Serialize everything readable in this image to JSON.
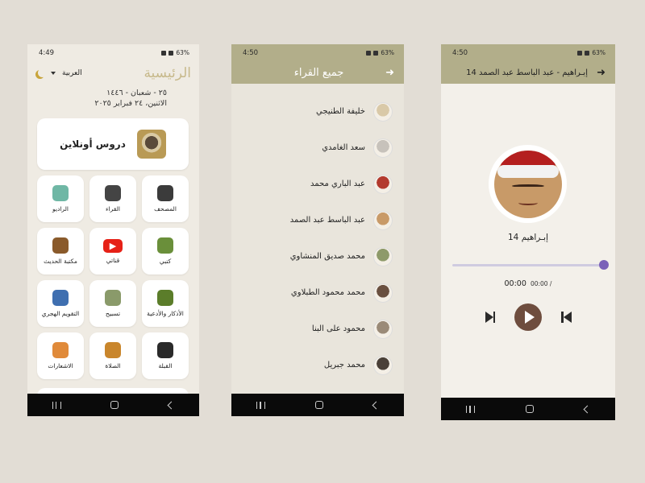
{
  "phone1": {
    "status": {
      "time": "4:49",
      "battery": "63%"
    },
    "header": {
      "title": "الرئيسية",
      "language": "العربية"
    },
    "dates": {
      "hijri": "٢٥ - شعبان - ١٤٤٦",
      "gregorian": "الاثنين، ٢٤ فبراير ٢٠٢٥"
    },
    "banner": {
      "label": "دروس أونلاين"
    },
    "tiles": [
      {
        "label": "المصحف",
        "icon": "quran-book-icon",
        "color": "#3b3b3b"
      },
      {
        "label": "القراء",
        "icon": "microphone-icon",
        "color": "#444444"
      },
      {
        "label": "الراديو",
        "icon": "radio-icon",
        "color": "#6fb7a5"
      },
      {
        "label": "كتبي",
        "icon": "books-icon",
        "color": "#6a8f3a"
      },
      {
        "label": "قناتي",
        "icon": "youtube-icon",
        "color": "#e62117"
      },
      {
        "label": "مكتبة الحديث",
        "icon": "library-icon",
        "color": "#8a5a2b"
      },
      {
        "label": "الأذكار والأدعية",
        "icon": "prayer-hands-icon",
        "color": "#5b7d2a"
      },
      {
        "label": "تسبيح",
        "icon": "tasbih-icon",
        "color": "#8a9a6a"
      },
      {
        "label": "التقويم الهجري",
        "icon": "calendar-icon",
        "color": "#3f6fb0"
      },
      {
        "label": "القبلة",
        "icon": "kaaba-icon",
        "color": "#2a2a2a"
      },
      {
        "label": "الصلاة",
        "icon": "mosque-icon",
        "color": "#c9862c"
      },
      {
        "label": "الاشعارات",
        "icon": "bell-icon",
        "color": "#e08a3a"
      }
    ]
  },
  "phone2": {
    "status": {
      "time": "4:50",
      "battery": "63%"
    },
    "header": {
      "title": "جميع القراء"
    },
    "readers": [
      {
        "name": "خليفة الطنيجي",
        "avatar_color": "#d9c9a8"
      },
      {
        "name": "سعد الغامدي",
        "avatar_color": "#c7c2bb"
      },
      {
        "name": "عبد الباري محمد",
        "avatar_color": "#b33a2e"
      },
      {
        "name": "عبد الباسط عبد الصمد",
        "avatar_color": "#c89a68"
      },
      {
        "name": "محمد صديق المنشاوي",
        "avatar_color": "#8e9a6a"
      },
      {
        "name": "محمد محمود الطبلاوي",
        "avatar_color": "#6a5040"
      },
      {
        "name": "محمود على البنا",
        "avatar_color": "#9a8a78"
      },
      {
        "name": "محمد جبريل",
        "avatar_color": "#4a4038"
      }
    ]
  },
  "phone3": {
    "status": {
      "time": "4:50",
      "battery": "63%"
    },
    "header": {
      "title": "14 إبـراهيم - عبد الباسط عبد الصمد"
    },
    "track": {
      "name": "14 إبـراهيم",
      "progress": 1.0
    },
    "times": {
      "current": "00:00",
      "total": "00:00 /"
    }
  },
  "colors": {
    "olive": "#b2ae8a",
    "play_button": "#6e4d3e",
    "seek_thumb": "#7b62b8",
    "title_gold": "#c7b98b"
  }
}
